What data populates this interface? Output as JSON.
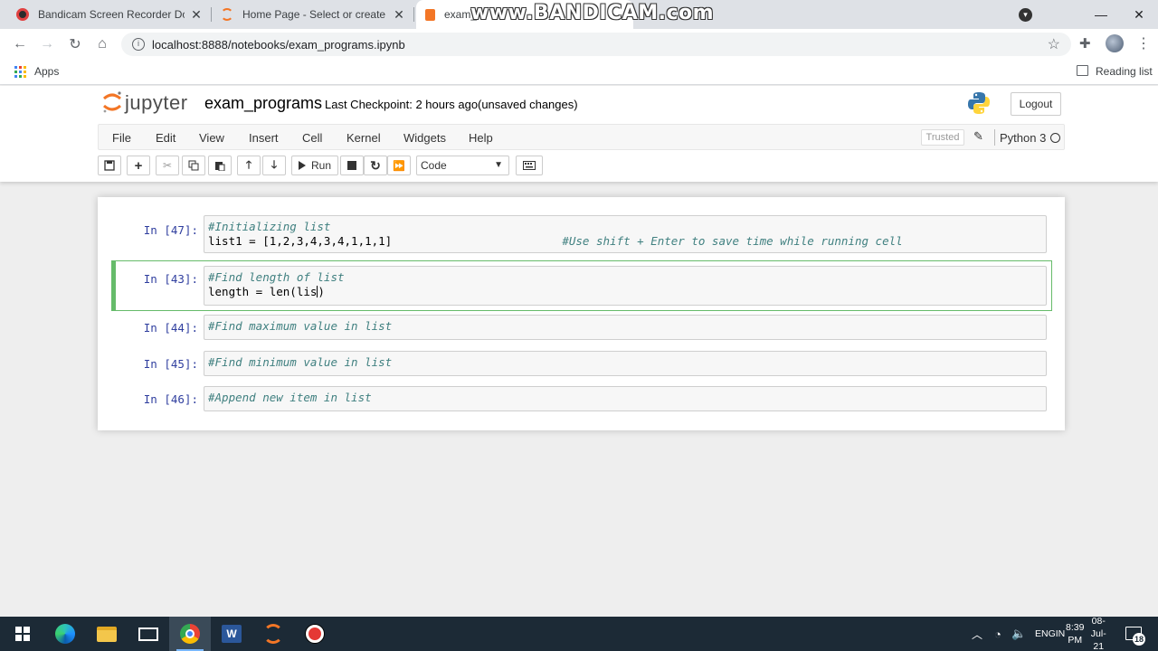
{
  "browser": {
    "tabs": [
      {
        "title": "Bandicam Screen Recorder Down",
        "close": "✕"
      },
      {
        "title": "Home Page - Select or create a n",
        "close": "✕"
      },
      {
        "title": "exam_",
        "close": "✕"
      }
    ],
    "watermark": "www.BANDICAM.com",
    "window_controls": {
      "minimize": "—",
      "maximize": "❐",
      "close": "✕"
    },
    "url": "localhost:8888/notebooks/exam_programs.ipynb",
    "bookmarks": {
      "apps_label": "Apps",
      "reading_list_label": "Reading list"
    }
  },
  "jupyter": {
    "logo_text": "jupyter",
    "notebook_name": "exam_programs",
    "checkpoint": "Last Checkpoint: 2 hours ago",
    "status": "(unsaved changes)",
    "logout_label": "Logout",
    "menu": [
      "File",
      "Edit",
      "View",
      "Insert",
      "Cell",
      "Kernel",
      "Widgets",
      "Help"
    ],
    "trusted_label": "Trusted",
    "kernel_name": "Python 3",
    "toolbar": {
      "run_label": "Run",
      "cell_type": "Code"
    }
  },
  "cells": [
    {
      "prompt": "In [47]:",
      "lines": [
        {
          "comment": "#Initializing list"
        },
        {
          "code": "list1 = [1,2,3,4,3,4,1,1,1]",
          "trailing_comment": "#Use shift + Enter to save time while running cell"
        }
      ]
    },
    {
      "prompt": "In [43]:",
      "selected": true,
      "lines": [
        {
          "comment": "#Find length of list"
        },
        {
          "code_before_cursor": "length = len(lis",
          "code_after_cursor": ")"
        }
      ]
    },
    {
      "prompt": "In [44]:",
      "lines": [
        {
          "comment": "#Find maximum value in list"
        }
      ]
    },
    {
      "prompt": "In [45]:",
      "lines": [
        {
          "comment": "#Find minimum value in list"
        }
      ]
    },
    {
      "prompt": "In [46]:",
      "lines": [
        {
          "comment": "#Append new item in list"
        }
      ]
    }
  ],
  "taskbar": {
    "language": "ENG",
    "region": "IN",
    "time": "8:39 PM",
    "date": "08-Jul-21",
    "notifications": "18",
    "pinned_icons": [
      "windows-start-icon",
      "edge-icon",
      "file-explorer-icon",
      "mail-icon",
      "chrome-icon",
      "word-icon",
      "jupyter-icon",
      "bandicam-record-icon"
    ]
  }
}
